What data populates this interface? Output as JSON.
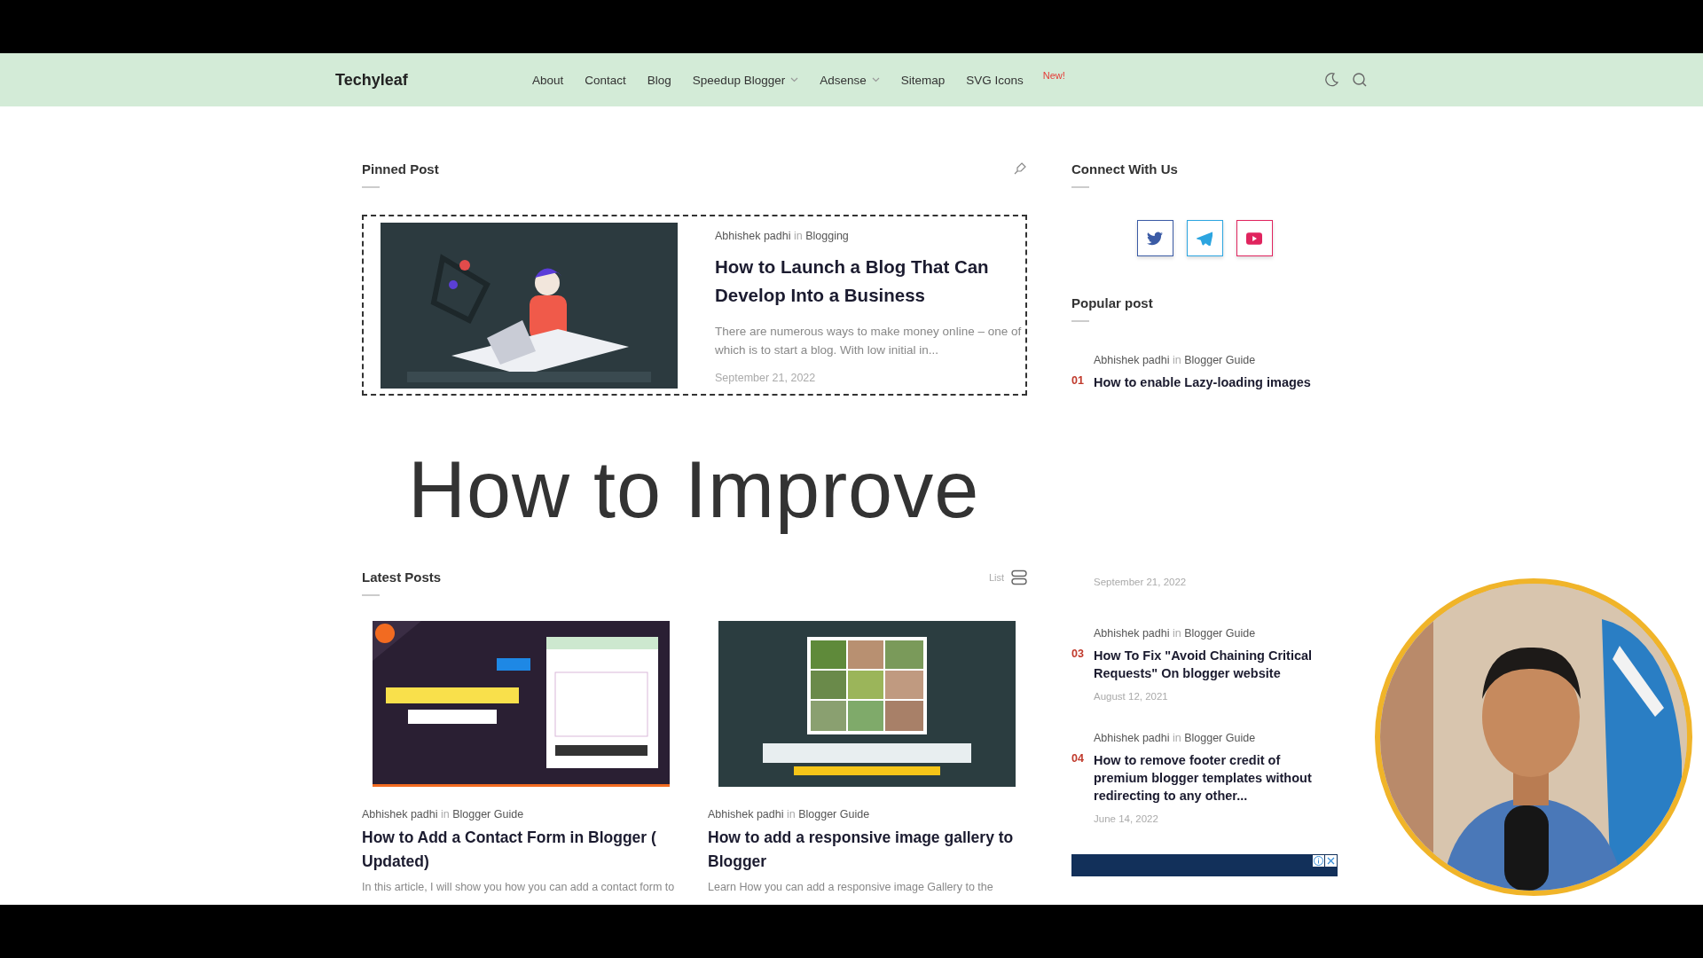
{
  "header": {
    "logo": "Techyleaf",
    "nav": [
      {
        "label": "About",
        "dropdown": false
      },
      {
        "label": "Contact",
        "dropdown": false
      },
      {
        "label": "Blog",
        "dropdown": false
      },
      {
        "label": "Speedup Blogger",
        "dropdown": true
      },
      {
        "label": "Adsense",
        "dropdown": true
      },
      {
        "label": "Sitemap",
        "dropdown": false
      },
      {
        "label": "SVG Icons",
        "dropdown": false,
        "badge": "New!"
      }
    ]
  },
  "pinned": {
    "heading": "Pinned Post",
    "post": {
      "author": "Abhishek padhi",
      "in": "in",
      "category": "Blogging",
      "title": "How to Launch a Blog That Can Develop Into a Business",
      "excerpt": "There are numerous ways to make money online – one of which is to start a blog. With low initial in...",
      "date": "September 21, 2022"
    }
  },
  "overlay_title": "How to Improve",
  "latest": {
    "heading": "Latest Posts",
    "view_label": "List",
    "posts": [
      {
        "author": "Abhishek padhi",
        "in": "in",
        "category": "Blogger Guide",
        "title": "How to Add a Contact Form in Blogger ( Updated)",
        "excerpt": "In this article, I will show you how you can add a contact form to"
      },
      {
        "author": "Abhishek padhi",
        "in": "in",
        "category": "Blogger Guide",
        "title": "How to add a responsive image gallery to Blogger",
        "excerpt": "Learn How you can add a responsive image Gallery to the"
      }
    ]
  },
  "sidebar": {
    "connect": {
      "heading": "Connect With Us",
      "links": [
        {
          "kind": "twitter",
          "color": "#3b5ba5"
        },
        {
          "kind": "telegram",
          "color": "#2ca5e0"
        },
        {
          "kind": "youtube",
          "color": "#e0245e"
        }
      ]
    },
    "popular": {
      "heading": "Popular post",
      "items": [
        {
          "number": "01",
          "author": "Abhishek padhi",
          "in": "in",
          "category": "Blogger Guide",
          "title": "How to enable Lazy-loading images"
        },
        {
          "date": "September 21, 2022"
        },
        {
          "number": "03",
          "author": "Abhishek padhi",
          "in": "in",
          "category": "Blogger Guide",
          "title": "How To Fix \"Avoid Chaining Critical Requests\" On blogger website",
          "date": "August 12, 2021"
        },
        {
          "number": "04",
          "author": "Abhishek padhi",
          "in": "in",
          "category": "Blogger Guide",
          "title": "How to remove footer credit of premium blogger templates without redirecting to any other...",
          "date": "June 14, 2022"
        }
      ]
    }
  }
}
